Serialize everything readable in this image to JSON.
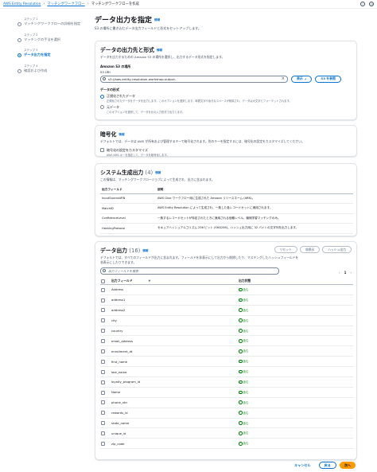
{
  "breadcrumb": [
    "AWS Entity Resolution",
    "マッチングワークフロー",
    "マッチングワークフローを作成"
  ],
  "steps": [
    {
      "num": "ステップ 1",
      "label": "マッチングワークフローの詳細を指定"
    },
    {
      "num": "ステップ 2",
      "label": "マッチングの手法を選択"
    },
    {
      "num": "ステップ 3",
      "label": "データ出力を指定"
    },
    {
      "num": "ステップ 4",
      "label": "確認および作成"
    }
  ],
  "page": {
    "title": "データ出力を指定",
    "info": "情報",
    "desc": "S3 の場所に書き込むデータ出力フィールドと形式をセットアップします。"
  },
  "dest": {
    "title": "データの出力先と形式",
    "info": "情報",
    "desc": "データを出力するための Amazon S3 の場所を選択し、出力するデータ形式を指定します。",
    "s3_label": "Amazon S3 の場所",
    "s3_uri_label": "S3 URI",
    "s3_value": "s3://aws-entity-resolution-workshop-output-",
    "view_btn": "表示",
    "browse_btn": "S3 を参照",
    "format_label": "データの形式",
    "normalized_label": "正規化されたデータ",
    "normalized_desc": "正規化されたデータをデータを出力します。このオプションを選択します。時間文字や余分なスペースが削除され、データは大文字とフォーマットされます。",
    "raw_label": "元データ",
    "raw_desc": "このオプションを選択して、データを元の入力形式で出力します。"
  },
  "encryption": {
    "title": "暗号化",
    "info": "情報",
    "desc": "デフォルトでは、データは AWS が所有および管理するキーで暗号化されます。別のキーを指定するには、暗号化の設定をカスタマイズしてください。",
    "custom_label": "暗号化の設定をカスタマイズ",
    "custom_desc": "AWS KMS キーを指定して、データを暗号化します。"
  },
  "system": {
    "title": "システム生成出力",
    "count": "(4)",
    "info": "情報",
    "desc": "この情報は、マッチングワークフロージョブによって生成され、出力に含まれます。",
    "col_field": "出力フィールド",
    "col_desc": "説明",
    "rows": [
      {
        "field": "InputSourceARN",
        "desc": "AWS Glue ワークフロー用に生成された Amazon リソースネーム (ARN)。"
      },
      {
        "field": "MatchID",
        "desc": "AWS Entity Resolution によって生成され、一致した各レコードセットに適用されます。"
      },
      {
        "field": "ConfidenceLevel",
        "desc": "一致するレコードセットが特定されたときに適用される信頼レベル。機械学習マッチングのみ。"
      },
      {
        "field": "HashingProtocol",
        "desc": "セキュアハッシュアルゴリズム 256 ビット (SHA256)。ハッシュ出力用に 32 バイトの文字列を出力します。"
      }
    ]
  },
  "output": {
    "title": "データ出力",
    "count": "(16)",
    "info": "情報",
    "desc": "デフォルトでは、すべてのフィールドが出力に含まれます。フィールドを非表示にして出力から削除したり、マスキングしたハッシュフィールドを非表示にしたりできます。",
    "btn_reset": "リセット",
    "btn_hide": "非表示",
    "btn_hash": "ハッシュ出力",
    "filter_placeholder": "出力フィールドを検索",
    "page_num": "1",
    "col_field": "出力フィールド",
    "col_status": "出力状態",
    "status_label": "含む",
    "fields": [
      "Address",
      "address1",
      "address2",
      "city",
      "country",
      "email_address",
      "enrollment_dt",
      "first_name",
      "last_name",
      "loyalty_program_id",
      "Name",
      "phone_nbr",
      "rewards_id",
      "state_name",
      "unique_id",
      "zip_code"
    ]
  },
  "footer": {
    "cancel": "キャンセル",
    "back": "戻る",
    "next": "次へ"
  }
}
